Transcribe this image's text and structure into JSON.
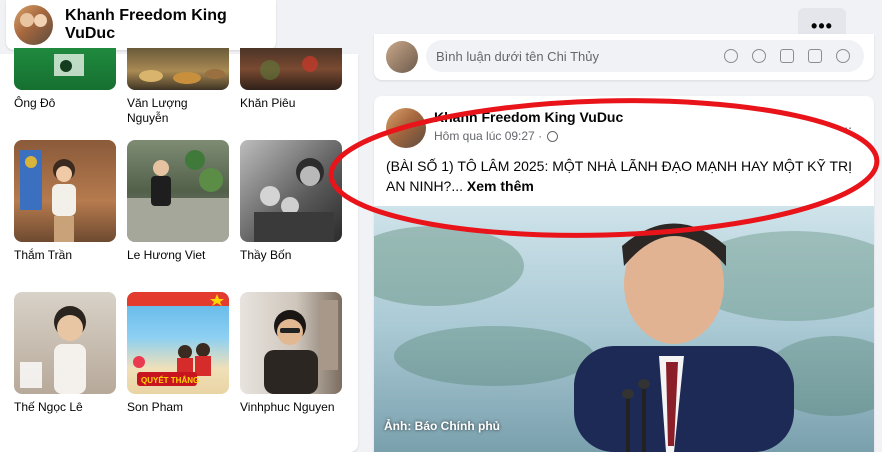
{
  "header": {
    "profile_name": "Khanh Freedom King VuDuc",
    "more_icon": "more-horizontal-icon"
  },
  "friends": [
    {
      "name": "Ông Đô"
    },
    {
      "name": "Văn Lượng Nguyễn"
    },
    {
      "name": "Khăn Piêu"
    },
    {
      "name": "Thắm Trần"
    },
    {
      "name": "Le Hương Viet"
    },
    {
      "name": "Thầy Bốn"
    },
    {
      "name": "Thế Ngọc Lê"
    },
    {
      "name": "Son Pham"
    },
    {
      "name": "Vinhphuc Nguyen"
    }
  ],
  "comment_box": {
    "placeholder": "Bình luận dưới tên Chi Thủy"
  },
  "post": {
    "author": "Khanh Freedom King VuDuc",
    "timestamp": "Hôm qua lúc 09:27 ·",
    "privacy_icon": "globe-icon",
    "more": "...",
    "text": "(BÀI SỐ 1) TÔ LÂM 2025: MỘT NHÀ LÃNH ĐẠO MẠNH HAY MỘT KỸ TRỊ AN NINH?...",
    "see_more": "Xem thêm",
    "image_caption": "Ảnh: Báo Chính phủ"
  },
  "colors": {
    "annotation_red": "#e8141a",
    "background": "#f0f2f5"
  }
}
